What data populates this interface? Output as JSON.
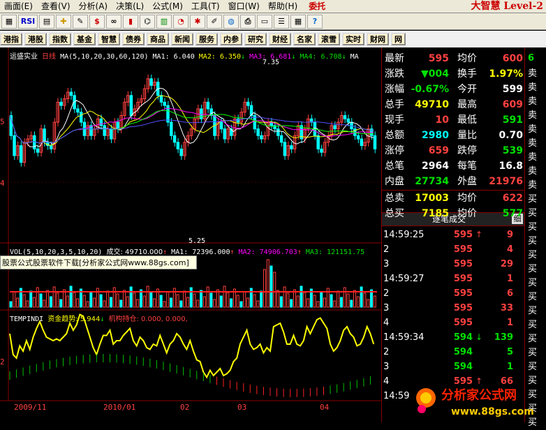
{
  "menu": {
    "items": [
      "画面(E)",
      "查看(V)",
      "分析(A)",
      "决策(L)",
      "公式(M)",
      "工具(T)",
      "窗口(W)",
      "帮助(H)"
    ],
    "entrust": "委托",
    "brand": "大智慧 Level-2"
  },
  "toolbar": {
    "rsi_label": "RSI",
    "dollar_label": "$"
  },
  "funcbar": {
    "items": [
      "港指",
      "港股",
      "指数",
      "基金",
      "智慧",
      "债券",
      "商品",
      "新闻",
      "服务",
      "内参",
      "研究",
      "财经",
      "名家",
      "滚雪",
      "实时",
      "财网",
      "网"
    ]
  },
  "stock": {
    "name": "运盛实业",
    "period": "日线"
  },
  "ma_legend": {
    "params": "MA(5,10,20,30,60,120)",
    "ma1": "MA1: 6.040",
    "ma2": "MA2: 6.350",
    "ma3": "MA3: 6.681",
    "ma4": "MA4: 6.708",
    "ma5": "MA"
  },
  "annotations": {
    "high": "7.35",
    "low": "5.25",
    "y_tick_5": "5",
    "y_tick_4": "4"
  },
  "popup": {
    "text": "股票公式股票软件下载[分析家公式网www.88gs.com]"
  },
  "vol_legend": {
    "params": "VOL(5,10,20,3,5,10,20)",
    "value": "成交: 49710.000",
    "ma1": "MA1: 72396.000",
    "ma2": "MA2: 74906.703",
    "ma3": "MA3: 121151.75"
  },
  "temp_legend": {
    "name": "TEMPINDI",
    "fund": "资金趋势: 5.944",
    "inst": "机构持仓: 0.000, 0.000,",
    "y_tick": "2"
  },
  "date_axis": {
    "labels": [
      "2009/11",
      "2010/01",
      "02",
      "03",
      "04"
    ]
  },
  "quote": {
    "latest_label": "最新",
    "latest": "595",
    "avg_label": "均价",
    "avg": "600",
    "change_label": "涨跌",
    "change": "▼004",
    "turnover_label": "换手",
    "turnover": "1.97%",
    "pct_label": "涨幅",
    "pct": "-0.67%",
    "open_label": "今开",
    "open": "599",
    "total_hands_label": "总手",
    "total_hands": "49710",
    "high_label": "最高",
    "high": "609",
    "cur_hands_label": "现手",
    "cur_hands": "10",
    "low_label": "最低",
    "low": "591",
    "amount_label": "总额",
    "amount": "2980",
    "vol_ratio_label": "量比",
    "vol_ratio": "0.70",
    "limit_up_label": "涨停",
    "limit_up": "659",
    "limit_down_label": "跌停",
    "limit_down": "539",
    "total_trades_label": "总笔",
    "total_trades": "2964",
    "per_trade_label": "每笔",
    "per_trade": "16.8",
    "inner_label": "内盘",
    "inner": "27734",
    "outer_label": "外盘",
    "outer": "21976",
    "total_sell_label": "总卖",
    "total_sell": "17003",
    "sell_avg_label": "均价",
    "sell_avg": "622",
    "total_buy_label": "总买",
    "total_buy": "7185",
    "buy_avg_label": "均价",
    "buy_avg": "577"
  },
  "ticks": {
    "header": "逐笔成交",
    "detail": "细",
    "rows": [
      {
        "time": "14:59:25",
        "price": "595",
        "arrow": "↑",
        "vol": "9",
        "color": "r"
      },
      {
        "time": "2",
        "price": "595",
        "arrow": "",
        "vol": "4",
        "color": "r"
      },
      {
        "time": "3",
        "price": "595",
        "arrow": "",
        "vol": "29",
        "color": "r"
      },
      {
        "time": "14:59:27",
        "price": "595",
        "arrow": "",
        "vol": "1",
        "color": "r"
      },
      {
        "time": "2",
        "price": "595",
        "arrow": "",
        "vol": "6",
        "color": "r"
      },
      {
        "time": "3",
        "price": "595",
        "arrow": "",
        "vol": "33",
        "color": "r"
      },
      {
        "time": "4",
        "price": "595",
        "arrow": "",
        "vol": "1",
        "color": "r"
      },
      {
        "time": "14:59:34",
        "price": "594",
        "arrow": "↓",
        "vol": "139",
        "color": "g"
      },
      {
        "time": "2",
        "price": "594",
        "arrow": "",
        "vol": "5",
        "color": "g"
      },
      {
        "time": "3",
        "price": "594",
        "arrow": "",
        "vol": "1",
        "color": "g"
      },
      {
        "time": "4",
        "price": "595",
        "arrow": "↑",
        "vol": "66",
        "color": "r"
      },
      {
        "time": "14:59",
        "price": "",
        "arrow": "",
        "vol": "",
        "color": "r"
      }
    ]
  },
  "far_column": [
    "卖",
    "卖",
    "卖",
    "卖",
    "卖",
    "卖",
    "卖",
    "卖",
    "卖",
    "买",
    "买",
    "买",
    "买",
    "买",
    "买",
    "买",
    "买",
    "买",
    "买",
    "买",
    "买",
    "买",
    "买",
    "买",
    "买",
    "买"
  ],
  "far_top": "6",
  "watermark": {
    "title": "分析家公式网",
    "url": "www.88gs.com"
  }
}
